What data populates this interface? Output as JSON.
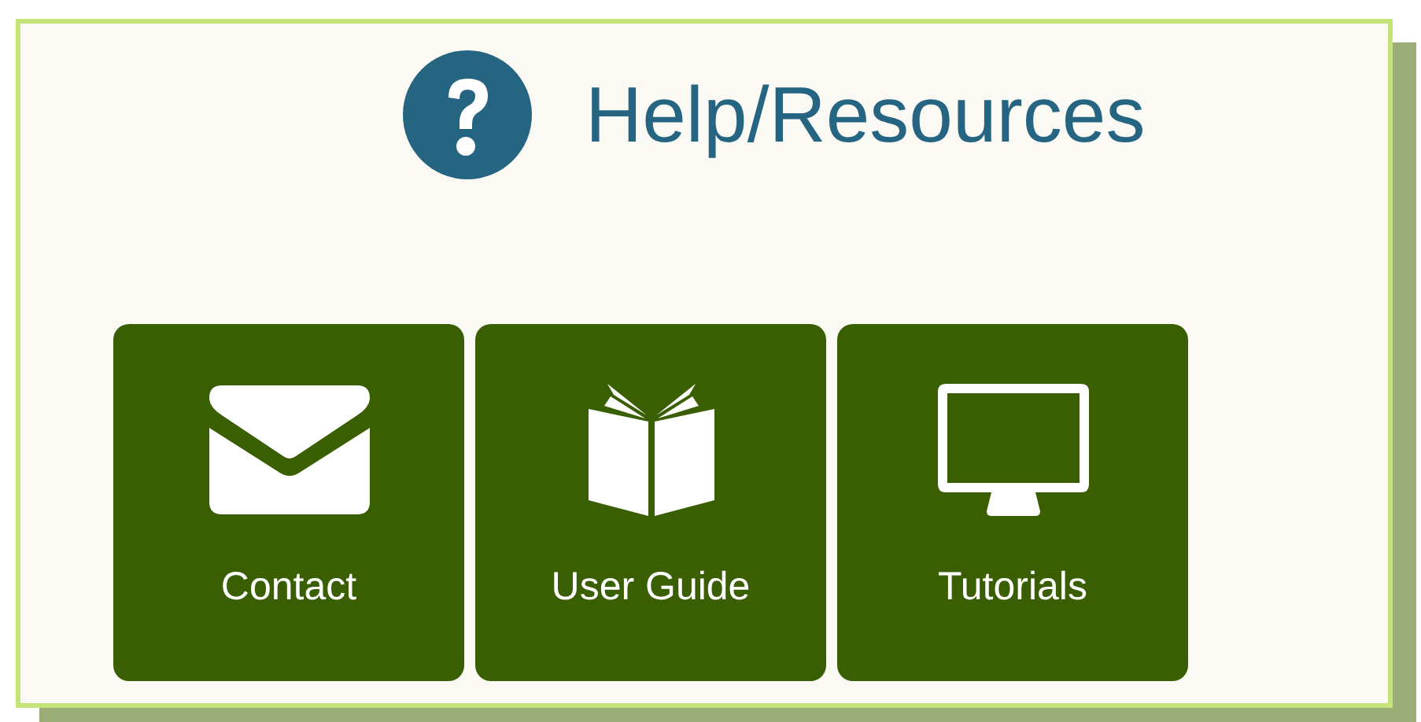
{
  "header": {
    "title": "Help/Resources"
  },
  "tiles": [
    {
      "label": "Contact"
    },
    {
      "label": "User Guide"
    },
    {
      "label": "Tutorials"
    }
  ]
}
